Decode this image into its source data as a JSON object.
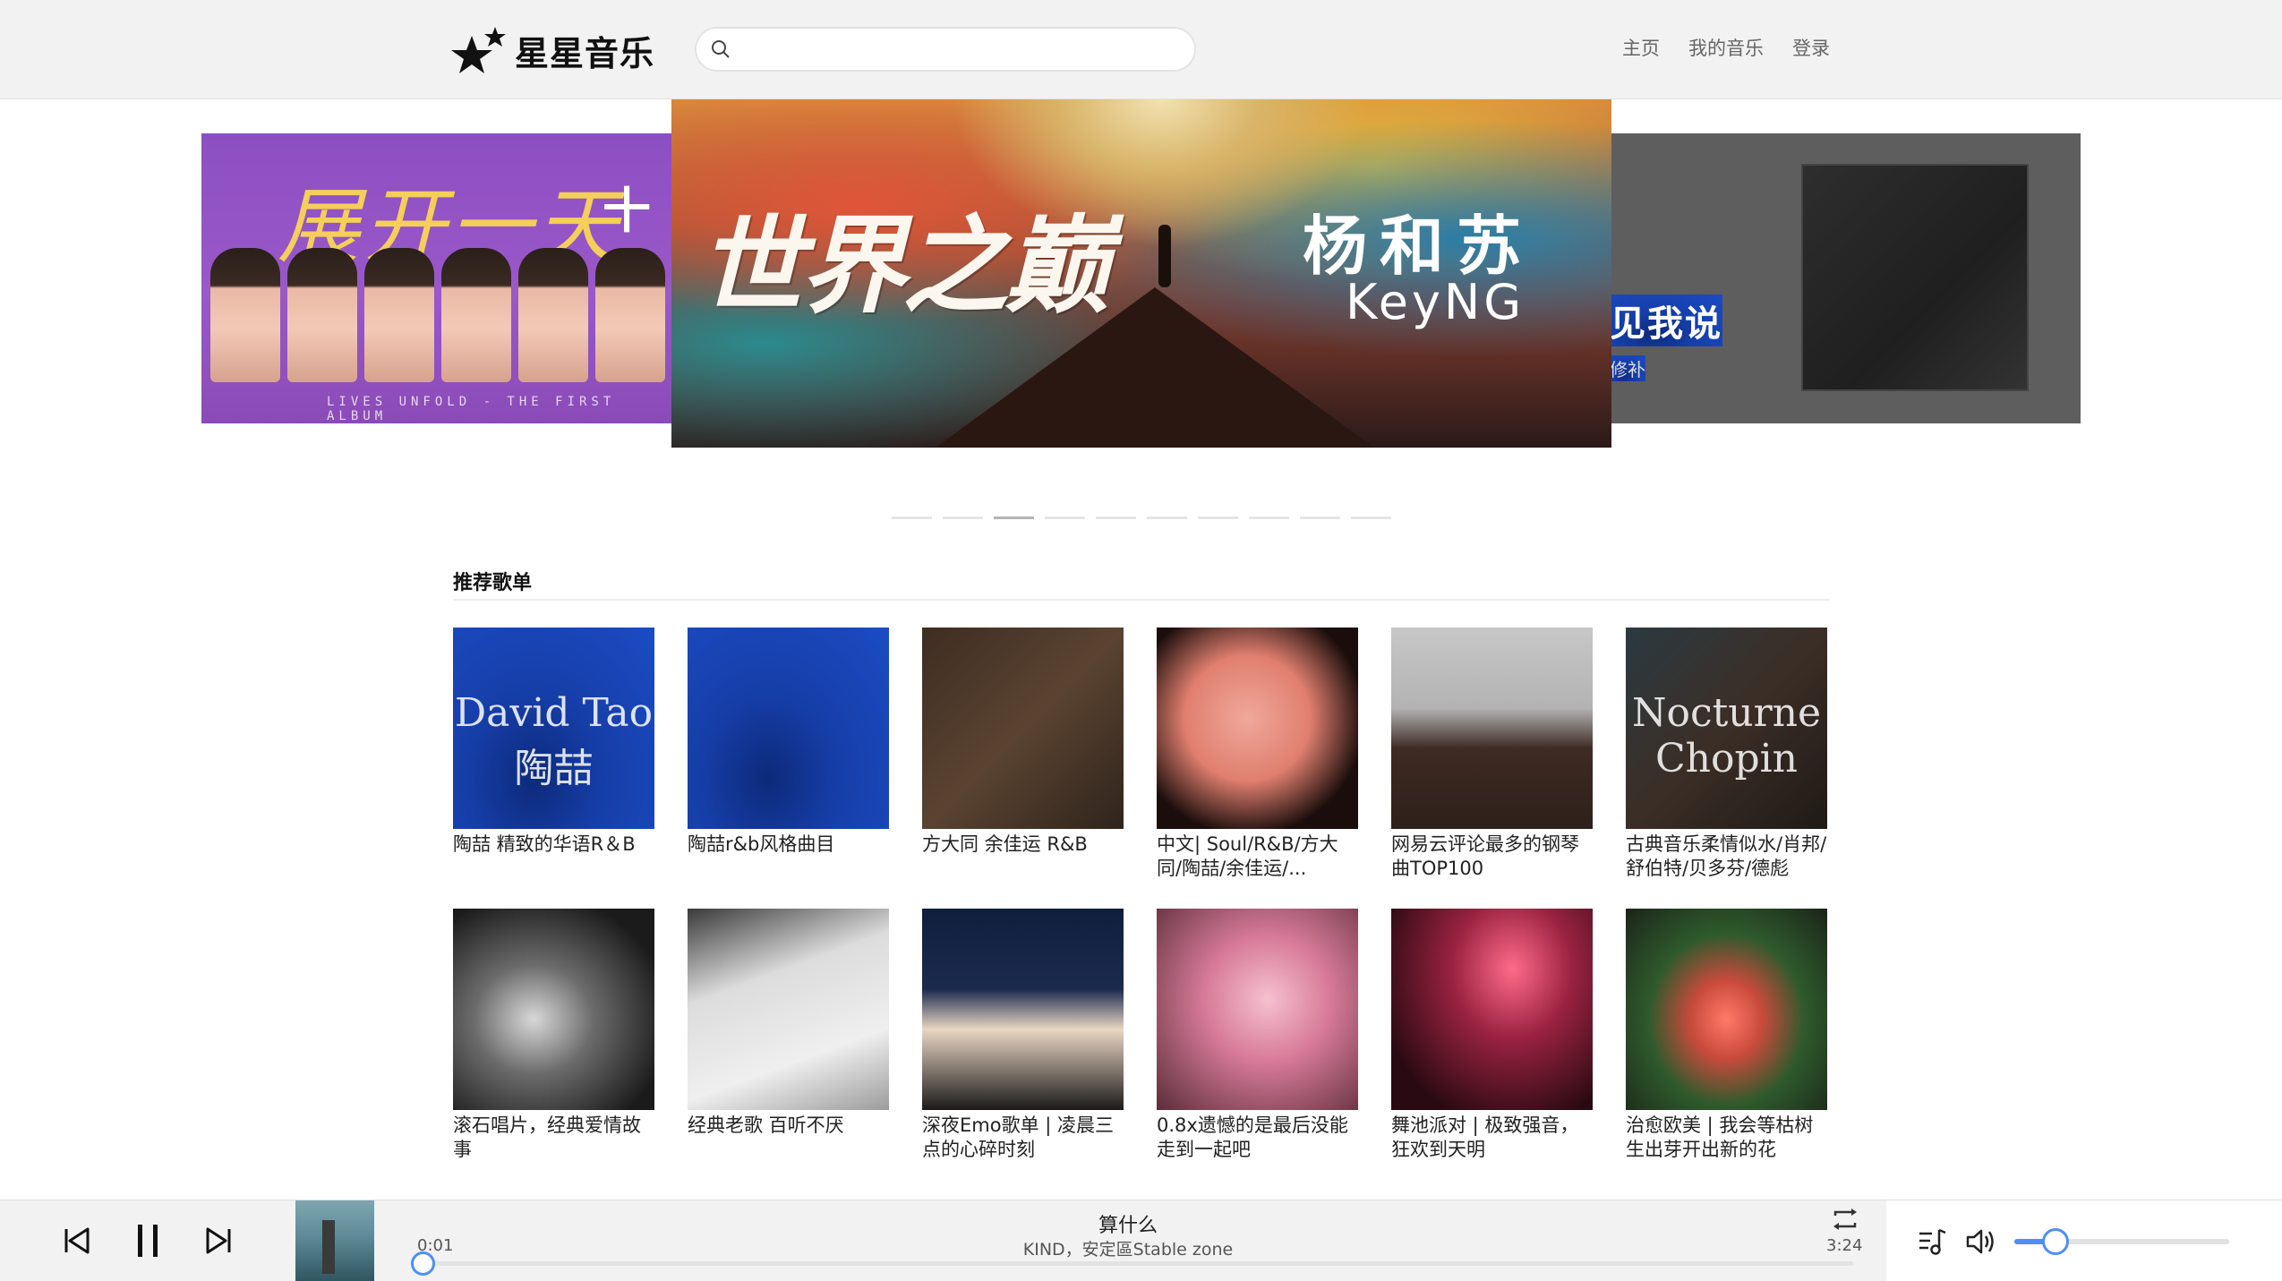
{
  "header": {
    "logo_text": "星星音乐",
    "search_placeholder": "",
    "nav": [
      "主页",
      "我的音乐",
      "登录"
    ]
  },
  "carousel": {
    "left": {
      "title": "展开一天",
      "title2": "十个",
      "subtitle": "LIVES UNFOLD - THE FIRST ALBUM"
    },
    "center": {
      "script": "世界之巅",
      "artist": "杨和苏",
      "artist_en": "KeyNG"
    },
    "right": {
      "title": "见我说",
      "subtitle": "修补"
    },
    "dot_count": 10,
    "active_dot": 2
  },
  "section": {
    "title": "推荐歌单"
  },
  "playlists": [
    {
      "name": "陶喆 精致的华语R＆B",
      "icon": "album-cover"
    },
    {
      "name": "陶喆r&b风格曲目",
      "icon": "album-cover"
    },
    {
      "name": "方大同 余佳运 R&B",
      "icon": "album-cover"
    },
    {
      "name": "中文| Soul/R&B/方大同/陶喆/余佳运/...",
      "icon": "album-cover"
    },
    {
      "name": "网易云评论最多的钢琴曲TOP100",
      "icon": "album-cover"
    },
    {
      "name": "古典音乐柔情似水/肖邦/舒伯特/贝多芬/德彪",
      "icon": "album-cover"
    },
    {
      "name": "滚石唱片，经典爱情故事",
      "icon": "album-cover"
    },
    {
      "name": "经典老歌 百听不厌",
      "icon": "album-cover"
    },
    {
      "name": "深夜Emo歌单 | 凌晨三点的心碎时刻",
      "icon": "album-cover"
    },
    {
      "name": "0.8x遗憾的是最后没能走到一起吧",
      "icon": "album-cover"
    },
    {
      "name": "舞池派对 | 极致强音，狂欢到天明",
      "icon": "album-cover"
    },
    {
      "name": "治愈欧美 | 我会等枯树生出芽开出新的花",
      "icon": "album-cover"
    }
  ],
  "cover_text": {
    "c1": "David Tao 陶喆",
    "c6": "Nocturne Chopin"
  },
  "player": {
    "song_title": "算什么",
    "song_artist": "KIND，安定區Stable zone",
    "current_time": "0:01",
    "total_time": "3:24",
    "progress": 0.005,
    "volume": 0.2,
    "accent": "#4f8ef7"
  }
}
